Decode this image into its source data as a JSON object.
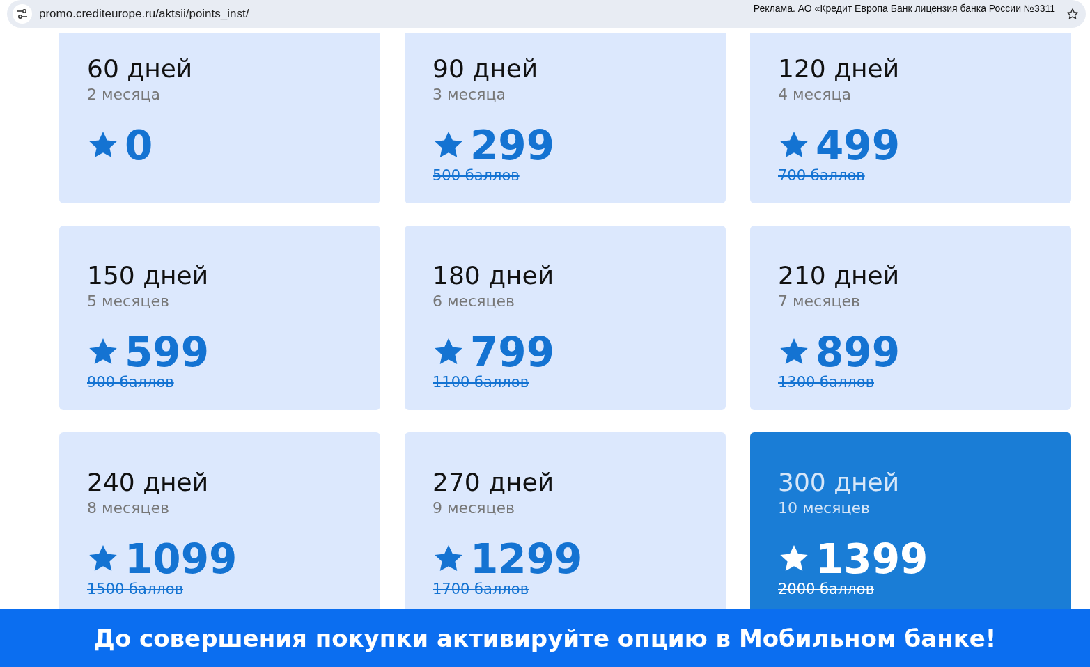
{
  "browser": {
    "url": "promo.crediteurope.ru/aktsii/points_inst/",
    "ad_notice": "Реклама. АО «Кредит Европа Банк лицензия банка России №3311"
  },
  "cards": [
    {
      "days": "60 дней",
      "months": "2 месяца",
      "price": "0",
      "selected": false
    },
    {
      "days": "90 дней",
      "months": "3 месяца",
      "price": "299",
      "old_price": "500 баллов",
      "selected": false
    },
    {
      "days": "120 дней",
      "months": "4 месяца",
      "price": "499",
      "old_price": "700 баллов",
      "selected": false
    },
    {
      "days": "150 дней",
      "months": "5 месяцев",
      "price": "599",
      "old_price": "900 баллов",
      "selected": false
    },
    {
      "days": "180 дней",
      "months": "6 месяцев",
      "price": "799",
      "old_price": "1100 баллов",
      "selected": false
    },
    {
      "days": "210 дней",
      "months": "7 месяцев",
      "price": "899",
      "old_price": "1300 баллов",
      "selected": false
    },
    {
      "days": "240 дней",
      "months": "8 месяцев",
      "price": "1099",
      "old_price": "1500 баллов",
      "selected": false
    },
    {
      "days": "270 дней",
      "months": "9 месяцев",
      "price": "1299",
      "old_price": "1700 баллов",
      "selected": false
    },
    {
      "days": "300 дней",
      "months": "10 месяцев",
      "price": "1399",
      "old_price": "2000 баллов",
      "selected": true
    }
  ],
  "banner": "До совершения покупки активируйте опцию в Мобильном банке!"
}
